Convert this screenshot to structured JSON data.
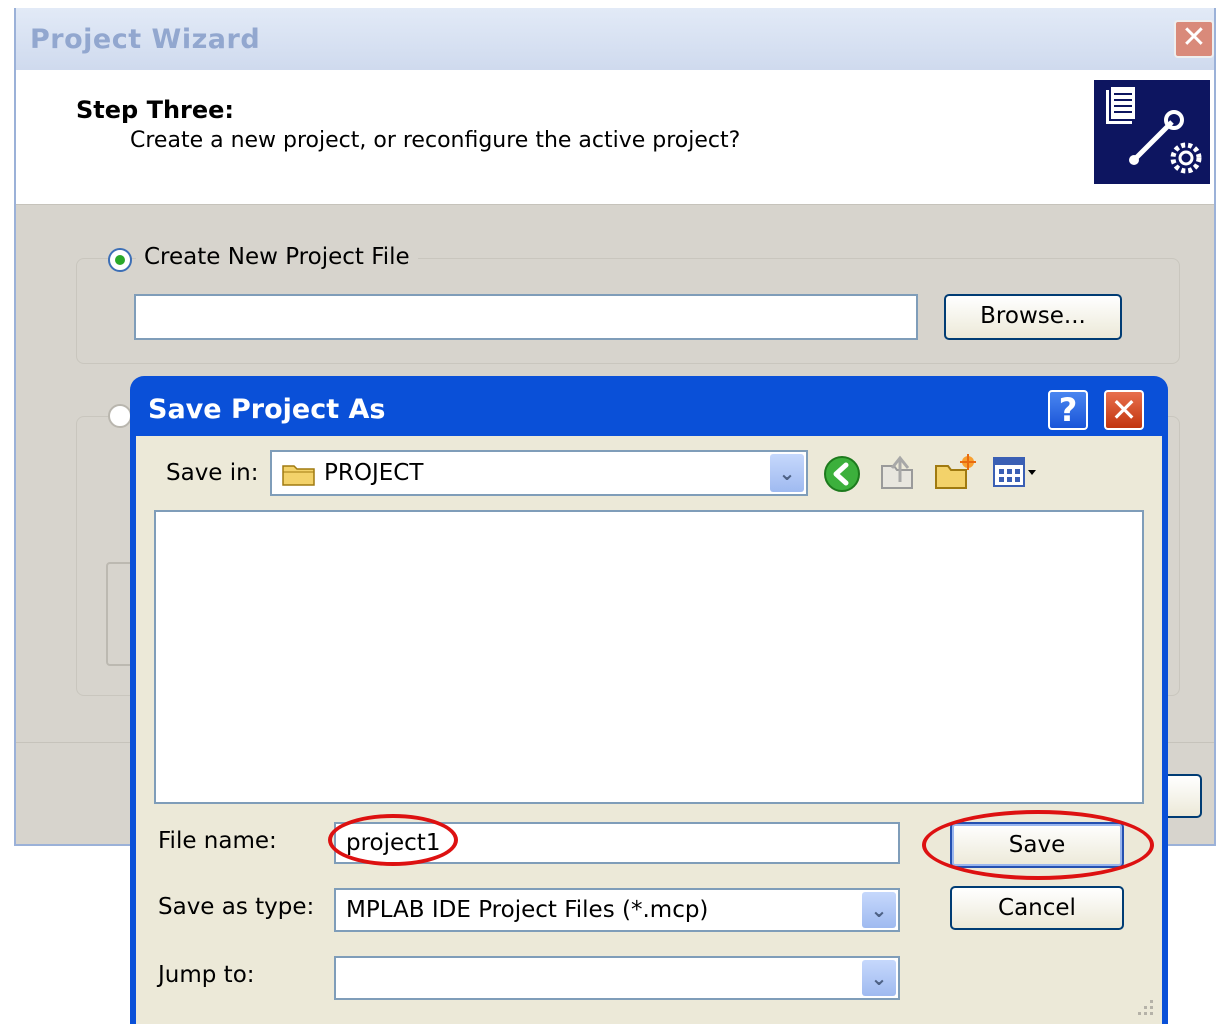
{
  "wizard": {
    "title": "Project Wizard",
    "close_glyph": "✕",
    "step_title": "Step Three:",
    "step_subtitle": "Create a new project, or reconfigure the active project?",
    "logo_icon": "document-wrench-gear-icon",
    "create_new_label": "Create New Project File",
    "create_new_selected": true,
    "browse_label": "Browse..."
  },
  "dialog": {
    "title": "Save Project As",
    "help_glyph": "?",
    "close_glyph": "✕",
    "save_in_label": "Save in:",
    "save_in_value": "PROJECT",
    "toolbar_icons": [
      "back-icon",
      "up-folder-icon",
      "new-folder-icon",
      "views-menu-icon"
    ],
    "file_name_label": "File name:",
    "file_name_value": "project1",
    "save_as_type_label": "Save as type:",
    "save_as_type_value": "MPLAB IDE Project Files (*.mcp)",
    "jump_to_label": "Jump to:",
    "jump_to_value": "",
    "save_label": "Save",
    "cancel_label": "Cancel",
    "highlight_color": "#dd1111"
  }
}
